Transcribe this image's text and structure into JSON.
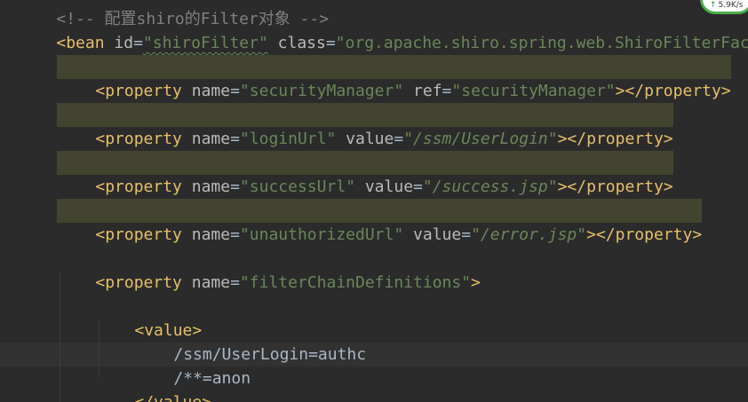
{
  "editor": {
    "top_comment": "<!-- 配置shiro的Filter对象 -->",
    "bean_line": {
      "open": "<bean",
      "id_attr": "id",
      "id_value": "\"shiroFilter\"",
      "class_attr": "class",
      "class_value": "\"org.apache.shiro.spring.web.ShiroFilterFactoryBean\">"
    },
    "properties": [
      {
        "open": "<property",
        "name_attr": "name",
        "name_value": "\"securityManager\"",
        "second_attr": "ref",
        "second_value": "\"securityManager\"",
        "close": "></property>"
      },
      {
        "open": "<property",
        "name_attr": "name",
        "name_value": "\"loginUrl\"",
        "second_attr": "value",
        "second_value": "\"/ssm/UserLogin\"",
        "close": "></property>"
      },
      {
        "open": "<property",
        "name_attr": "name",
        "name_value": "\"successUrl\"",
        "second_attr": "value",
        "second_value": "\"/success.jsp\"",
        "close": "></property>"
      },
      {
        "open": "<property",
        "name_attr": "name",
        "name_value": "\"unauthorizedUrl\"",
        "second_attr": "value",
        "second_value": "\"/error.jsp\"",
        "close": "></property>"
      }
    ],
    "filter_chain": {
      "open": "<property",
      "name_attr": "name",
      "name_value": "\"filterChainDefinitions\"",
      "close": ">"
    },
    "value_open": "<value>",
    "value_lines": [
      "/ssm/UserLogin=authc",
      "/**=anon"
    ],
    "value_close": "</value>"
  },
  "speed_widget": {
    "arrow": "↑",
    "value": "5.9K/s"
  }
}
